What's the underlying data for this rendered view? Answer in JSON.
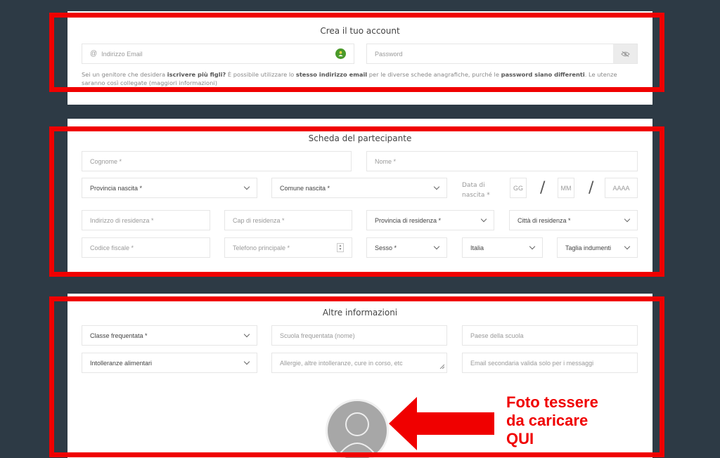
{
  "account": {
    "title": "Crea il tuo account",
    "email_placeholder": "Indirizzo Email",
    "password_placeholder": "Password",
    "note_1": "Sei un genitore che desidera ",
    "note_b1": "iscrivere più figli?",
    "note_2": " È possibile utilizzare lo ",
    "note_b2": "stesso indirizzo email",
    "note_3": " per le diverse schede anagrafiche, purché le ",
    "note_b3": "password siano differenti",
    "note_4": ". Le utenze saranno così collegate (maggiori informazioni)"
  },
  "participant": {
    "title": "Scheda del partecipante",
    "surname": "Cognome *",
    "name": "Nome *",
    "birth_province": "Provincia nascita *",
    "birth_city": "Comune nascita *",
    "birth_date_label": "Data di nascita *",
    "day": "GG",
    "month": "MM",
    "year": "AAAA",
    "separator": "/",
    "address": "Indirizzo di residenza *",
    "zip": "Cap di residenza *",
    "res_province": "Provincia di residenza *",
    "res_city": "Città di residenza *",
    "tax_code": "Codice fiscale *",
    "phone": "Telefono principale *",
    "sex": "Sesso *",
    "country": "Italia",
    "size": "Taglia indumenti"
  },
  "other": {
    "title": "Altre informazioni",
    "class": "Classe frequentata *",
    "school_name": "Scuola frequentata (nome)",
    "school_country": "Paese della scuola",
    "intolerance": "Intolleranze alimentari",
    "allergies": "Allergie, altre intolleranze, cure in corso, etc",
    "secondary_email": "Email secondaria valida solo per i messaggi"
  },
  "annotation": {
    "line1": "Foto tessere",
    "line2": "da caricare",
    "line3": "QUI"
  },
  "colors": {
    "background": "#2d3a45",
    "highlight": "#f00000",
    "badge": "#4a9a2a"
  },
  "icons": [
    "at-icon",
    "user-check-icon",
    "eye-off-icon",
    "chevron-down-icon",
    "spinner-icon",
    "resize-handle-icon",
    "avatar-placeholder-icon"
  ]
}
